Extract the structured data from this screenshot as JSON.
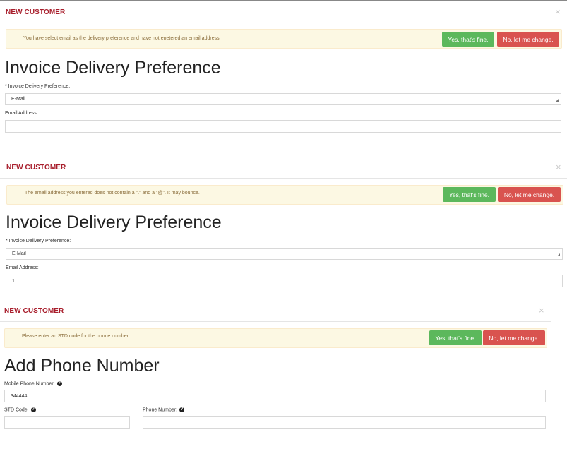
{
  "panels": [
    {
      "title": "NEW CUSTOMER",
      "close": "×",
      "alert_text": "You have select email as the delivery preference and have not enetered an email address.",
      "yes_label": "Yes, that's fine.",
      "no_label": "No, let me change.",
      "heading": "Invoice Delivery Preference",
      "pref_label": "* Invoice Delivery Preference:",
      "pref_value": "E-Mail",
      "email_label": "Email Address:",
      "email_value": ""
    },
    {
      "title": "NEW CUSTOMER",
      "close": "×",
      "alert_text": "The email address you entered does not contain a \".\" and a \"@\". It may bounce.",
      "yes_label": "Yes, that's fine.",
      "no_label": "No, let me change.",
      "heading": "Invoice Delivery Preference",
      "pref_label": "* Invoice Delivery Preference:",
      "pref_value": "E-Mail",
      "email_label": "Email Address:",
      "email_value": "1"
    },
    {
      "title": "NEW CUSTOMER",
      "close": "×",
      "alert_text": "Please enter an STD code for the phone number.",
      "yes_label": "Yes, that's fine.",
      "no_label": "No, let me change.",
      "heading": "Add Phone Number",
      "mobile_label": "Mobile Phone Number:",
      "mobile_value": "344444",
      "std_label": "STD Code:",
      "std_value": "",
      "phone_label": "Phone Number:",
      "phone_value": "",
      "help_glyph": "?"
    }
  ]
}
